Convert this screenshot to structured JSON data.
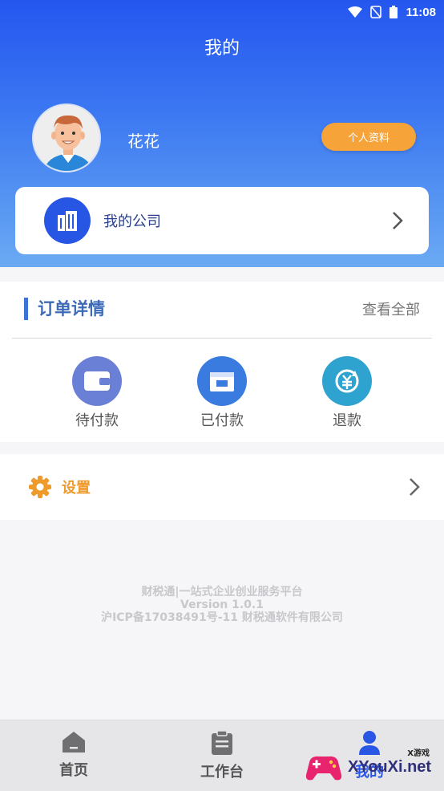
{
  "status_bar": {
    "time": "11:08"
  },
  "header": {
    "title": "我的"
  },
  "profile": {
    "username": "花花",
    "profile_button": "个人资料"
  },
  "company": {
    "label": "我的公司"
  },
  "orders": {
    "title": "订单详情",
    "view_all": "查看全部",
    "items": [
      {
        "label": "待付款",
        "icon": "wallet-icon",
        "color": "#6a80d6"
      },
      {
        "label": "已付款",
        "icon": "package-icon",
        "color": "#3a7be0"
      },
      {
        "label": "退款",
        "icon": "refund-icon",
        "color": "#2fa3d0"
      }
    ]
  },
  "settings": {
    "label": "设置",
    "color": "#ef9a2c"
  },
  "footer": {
    "line1": "财税通|一站式企业创业服务平台",
    "line2": "Version 1.0.1",
    "line3": "沪ICP备17038491号-11 财税通软件有限公司"
  },
  "tabs": [
    {
      "label": "首页",
      "icon": "home-icon"
    },
    {
      "label": "工作台",
      "icon": "clipboard-icon"
    },
    {
      "label": "我的",
      "icon": "user-icon"
    }
  ],
  "watermark": {
    "text": "XYouXi.net",
    "small": "X游戏"
  },
  "colors": {
    "primary": "#2456ef",
    "accent": "#f6a43a"
  }
}
